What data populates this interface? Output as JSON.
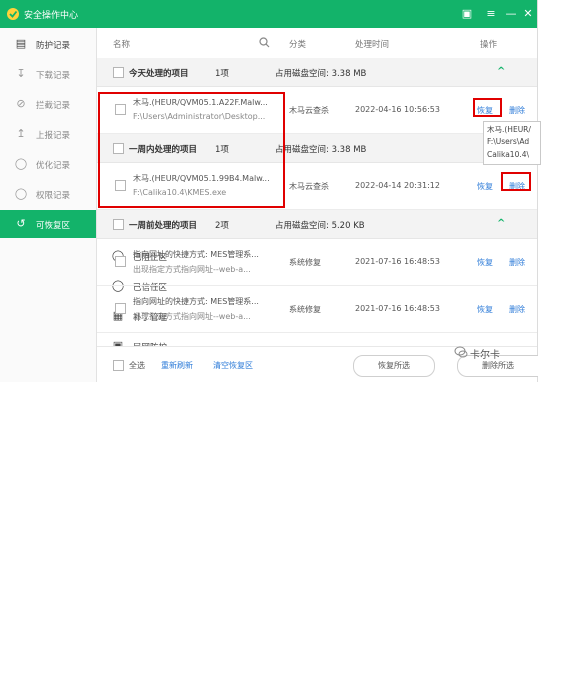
{
  "app": {
    "title": "安全操作中心"
  },
  "sidebar": {
    "items": [
      {
        "label": "防护记录",
        "icon": "document-icon"
      },
      {
        "label": "下载记录",
        "icon": "download-icon"
      },
      {
        "label": "拦截记录",
        "icon": "block-icon"
      },
      {
        "label": "上报记录",
        "icon": "upload-icon"
      },
      {
        "label": "优化记录",
        "icon": "optimize-icon"
      },
      {
        "label": "权限记录",
        "icon": "shield-icon"
      },
      {
        "label": "可恢复区",
        "icon": "restore-icon"
      },
      {
        "label": "已阻止区",
        "icon": "shield-block-icon"
      },
      {
        "label": "已信任区",
        "icon": "shield-check-icon"
      },
      {
        "label": "补丁管理",
        "icon": "patch-icon"
      },
      {
        "label": "局网防护",
        "icon": "network-icon"
      }
    ]
  },
  "columns": {
    "name": "名称",
    "category": "分类",
    "time": "处理时间",
    "action": "操作"
  },
  "groups": [
    {
      "label": "今天处理的项目",
      "count": "1项",
      "space": "占用磁盘空间: 3.38 MB"
    },
    {
      "label": "一周内处理的项目",
      "count": "1项",
      "space": "占用磁盘空间: 3.38 MB"
    },
    {
      "label": "一周前处理的项目",
      "count": "2项",
      "space": "占用磁盘空间: 5.20 KB"
    }
  ],
  "rows": [
    {
      "line1": "木马.(HEUR/QVM05.1.A22F.Malw...",
      "line2": "F:\\Users\\Administrator\\Desktop...",
      "source": "木马云查杀",
      "time": "2022-04-16 10:56:53",
      "restore": "恢复",
      "delete": "删除"
    },
    {
      "line1": "木马.(HEUR/QVM05.1.99B4.Malw...",
      "line2": "F:\\Calika10.4\\KMES.exe",
      "source": "木马云查杀",
      "time": "2022-04-14 20:31:12",
      "restore": "恢复",
      "delete": "删除"
    },
    {
      "line1": "指向网址的快捷方式: MES管理系...",
      "line2": "出现指定方式指向网址--web-a...",
      "source": "系统修复",
      "time": "2021-07-16 16:48:53",
      "restore": "恢复",
      "delete": "删除"
    },
    {
      "line1": "指向网址的快捷方式: MES管理系...",
      "line2": "出现指定方式指向网址--web-a...",
      "source": "系统修复",
      "time": "2021-07-16 16:48:53",
      "restore": "恢复",
      "delete": "删除"
    }
  ],
  "tooltip": {
    "line1": "木马.(HEUR/",
    "line2": "F:\\Users\\Ad",
    "line3": "Calika10.4\\"
  },
  "footer": {
    "select_all": "全选",
    "refresh": "重新刷新",
    "clear": "清空恢复区",
    "restore_selected": "恢复所选",
    "delete_selected": "删除所选"
  },
  "watermark": "卡尔卡",
  "colors": {
    "accent": "#13b36a",
    "link": "#2d7bd8",
    "highlight": "#e00000"
  }
}
